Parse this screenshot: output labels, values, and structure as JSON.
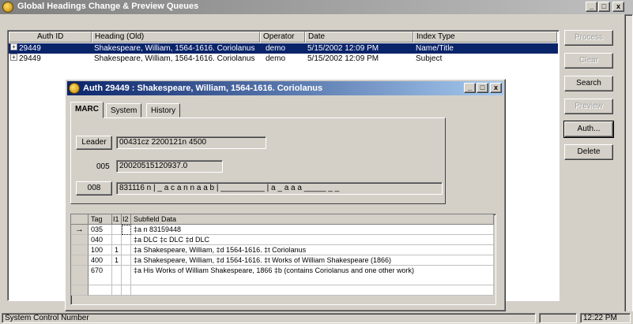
{
  "main_window": {
    "title": "Global Headings Change & Preview Queues",
    "caption_buttons": [
      "_",
      "□",
      "x"
    ]
  },
  "queue_list": {
    "columns": [
      "Auth ID",
      "Heading (Old)",
      "Operator",
      "Date",
      "Index Type"
    ],
    "rows": [
      {
        "expander": "+",
        "auth_id": "29449",
        "heading": "Shakespeare, William, 1564-1616. Coriolanus",
        "operator": "demo",
        "date": "5/15/2002 12:09 PM",
        "index_type": "Name/Title"
      },
      {
        "expander": "+",
        "auth_id": "29449",
        "heading": "Shakespeare, William, 1564-1616. Coriolanus",
        "operator": "demo",
        "date": "5/15/2002 12:09 PM",
        "index_type": "Subject"
      }
    ]
  },
  "side_buttons": {
    "process": "Process",
    "clear": "Clear",
    "search": "Search",
    "preview": "Preview",
    "auth": "Auth...",
    "delete": "Delete"
  },
  "auth_window": {
    "title": "Auth 29449 : Shakespeare, William, 1564-1616. Coriolanus",
    "caption_buttons": [
      "_",
      "□",
      "x"
    ],
    "tabs": [
      "MARC",
      "System",
      "History"
    ],
    "leader_label": "Leader",
    "leader_value": "00431cz  2200121n  4500",
    "f005_label": "005",
    "f005_value": "20020515120937.0",
    "f008_label": "008",
    "f008_value": "831116 n | _ a c a n n a a b | __________ | a _ a a a _____ _ _"
  },
  "marc_grid": {
    "columns": [
      "Tag",
      "I1",
      "I2",
      "Subfield Data"
    ],
    "rows": [
      {
        "marker": "→",
        "tag": "035",
        "i1": "",
        "i2": "",
        "data": "‡a n  83159448"
      },
      {
        "marker": "",
        "tag": "040",
        "i1": "",
        "i2": "",
        "data": "‡a DLC ‡c DLC ‡d DLC"
      },
      {
        "marker": "",
        "tag": "100",
        "i1": "1",
        "i2": "",
        "data": "‡a Shakespeare, William, ‡d 1564-1616. ‡t Coriolanus"
      },
      {
        "marker": "",
        "tag": "400",
        "i1": "1",
        "i2": "",
        "data": "‡a Shakespeare, William, ‡d 1564-1616. ‡t Works of William Shakespeare (1866)"
      },
      {
        "marker": "",
        "tag": "670",
        "i1": "",
        "i2": "",
        "data": "‡a His Works of William Shakespeare, 1866 ‡b (contains Coriolanus and one other work)"
      }
    ]
  },
  "status_bar": {
    "message": "System Control Number",
    "time": "12:22 PM"
  },
  "colors": {
    "selection": "#0a246a",
    "face": "#d4d0c8",
    "active_title_start": "#0a246a",
    "active_title_end": "#a6caf0"
  }
}
